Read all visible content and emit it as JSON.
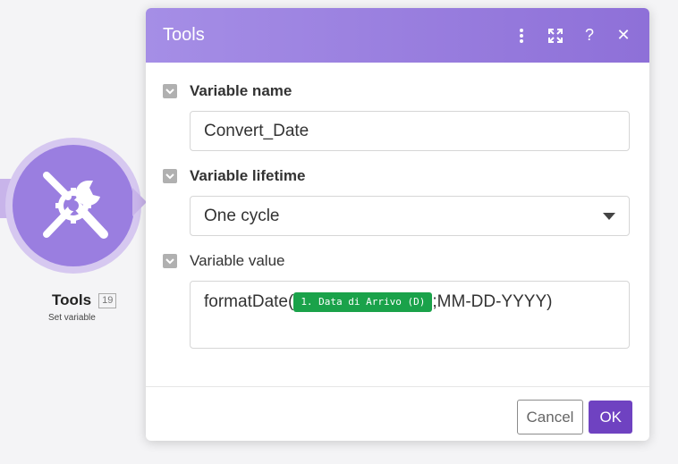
{
  "module": {
    "name": "Tools",
    "badge": "19",
    "subtitle": "Set variable",
    "icon": "tools-icon"
  },
  "dialog": {
    "title": "Tools",
    "header_icons": [
      "more-vert-icon",
      "expand-icon",
      "help-icon",
      "close-icon"
    ],
    "sections": {
      "name": {
        "label": "Variable name",
        "value": "Convert_Date"
      },
      "lifetime": {
        "label": "Variable lifetime",
        "value": "One cycle"
      },
      "value": {
        "label": "Variable value",
        "prefix": "formatDate(",
        "pill": "1. Data di Arrivo (D)",
        "suffix": ";MM-DD-YYYY)"
      }
    },
    "buttons": {
      "cancel": "Cancel",
      "ok": "OK"
    }
  },
  "colors": {
    "accent": "#8e70d8",
    "ok_button": "#6f42c1",
    "pill": "#1aa24a"
  }
}
